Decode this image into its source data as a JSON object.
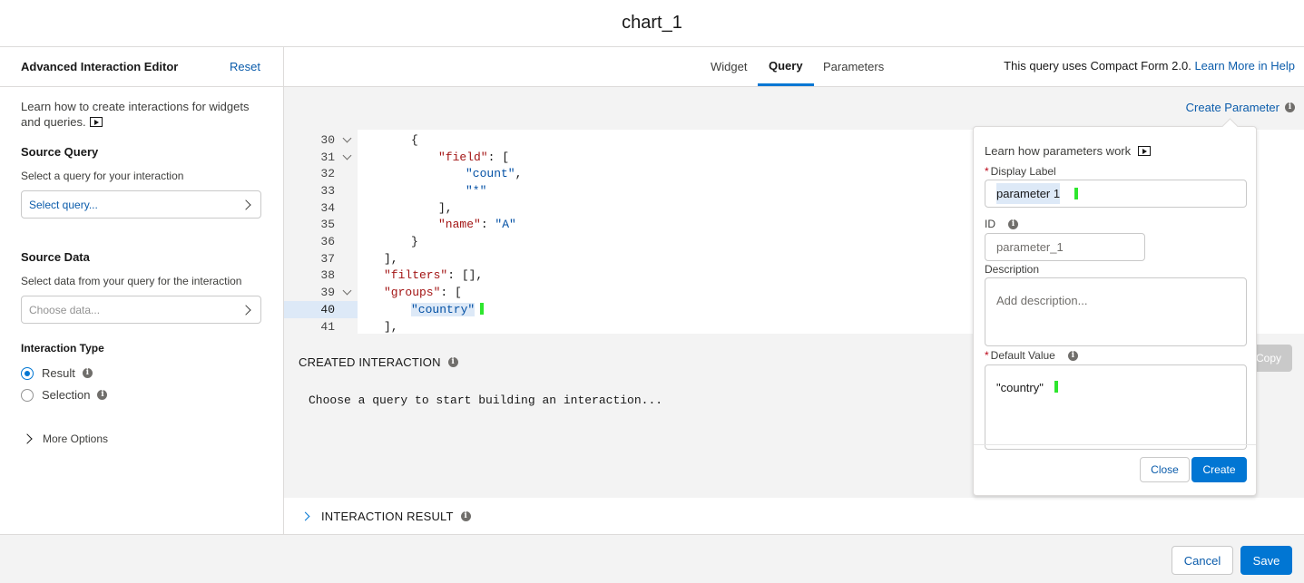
{
  "window": {
    "title": "chart_1"
  },
  "left_panel": {
    "title": "Advanced Interaction Editor",
    "reset_label": "Reset",
    "help_text": "Learn how to create interactions for widgets and queries.",
    "source_query": {
      "title": "Source Query",
      "subtitle": "Select a query for your interaction",
      "placeholder": "Select query..."
    },
    "source_data": {
      "title": "Source Data",
      "subtitle": "Select data from your query for the interaction",
      "placeholder": "Choose data..."
    },
    "interaction_type": {
      "title": "Interaction Type",
      "options": [
        {
          "label": "Result",
          "selected": true
        },
        {
          "label": "Selection",
          "selected": false
        }
      ]
    },
    "more_options_label": "More Options"
  },
  "tabs": {
    "items": [
      {
        "label": "Widget"
      },
      {
        "label": "Query",
        "active": true
      },
      {
        "label": "Parameters"
      }
    ],
    "note": "This query uses Compact Form 2.0.",
    "note_link": "Learn More in Help"
  },
  "create_parameter_link": "Create Parameter",
  "editor": {
    "lines": [
      {
        "n": "30",
        "fold": true,
        "code": "{"
      },
      {
        "n": "31",
        "fold": true,
        "code": "\"field\": ["
      },
      {
        "n": "32",
        "code": "\"count\","
      },
      {
        "n": "33",
        "code": "\"*\""
      },
      {
        "n": "34",
        "code": "],"
      },
      {
        "n": "35",
        "code": "\"name\": \"A\""
      },
      {
        "n": "36",
        "code": "}"
      },
      {
        "n": "37",
        "code": "],"
      },
      {
        "n": "38",
        "code": "\"filters\": [],"
      },
      {
        "n": "39",
        "fold": true,
        "code": "\"groups\": ["
      },
      {
        "n": "40",
        "code": "\"country\"",
        "current": true
      },
      {
        "n": "41",
        "code": "],"
      }
    ]
  },
  "created_interaction": {
    "title": "CREATED INTERACTION",
    "placeholder_text": "Choose a query to start building an interaction...",
    "copy_label": "Copy"
  },
  "interaction_result": {
    "title": "INTERACTION RESULT"
  },
  "popover": {
    "help_text": "Learn how parameters work",
    "display_label": {
      "label": "Display Label",
      "value": "parameter 1"
    },
    "id": {
      "label": "ID",
      "value": "parameter_1"
    },
    "description": {
      "label": "Description",
      "placeholder": "Add description..."
    },
    "default_value": {
      "label": "Default Value",
      "value": "\"country\""
    },
    "close_label": "Close",
    "create_label": "Create"
  },
  "footer": {
    "cancel_label": "Cancel",
    "save_label": "Save"
  },
  "colors": {
    "brand": "#0176d3",
    "link": "#0b5cab",
    "cursor": "#2ee62e",
    "required": "#ba0517"
  }
}
